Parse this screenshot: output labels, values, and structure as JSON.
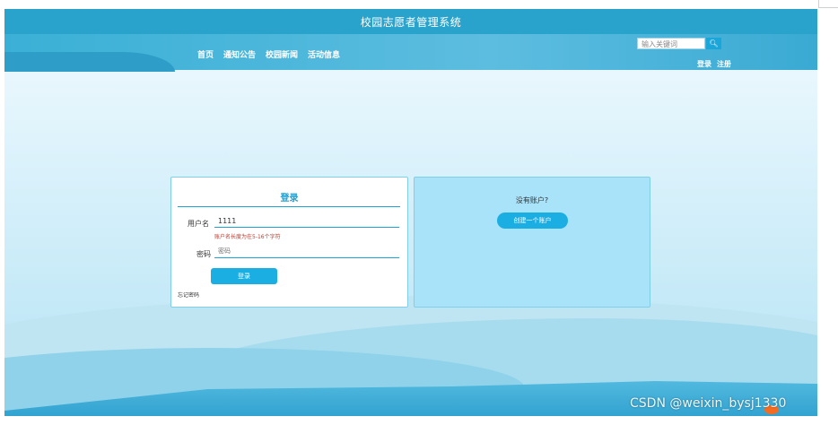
{
  "site": {
    "title": "校园志愿者管理系统"
  },
  "nav": {
    "items": [
      "首页",
      "通知公告",
      "校园新闻",
      "活动信息"
    ]
  },
  "search": {
    "placeholder": "输入关键词",
    "button_icon": "search-icon"
  },
  "auth": {
    "login": "登录",
    "register": "注册"
  },
  "login_form": {
    "title": "登录",
    "username_label": "用户名",
    "username_value": "1111",
    "username_error": "账户名长度为在5-16个字符",
    "password_label": "密码",
    "password_placeholder": "密码",
    "submit_label": "登录",
    "forgot_label": "忘记密码"
  },
  "register_panel": {
    "prompt": "没有账户?",
    "button_label": "创建一个账户"
  },
  "watermark": "CSDN @weixin_bysj1330",
  "colors": {
    "header": "#2aa3cc",
    "accent": "#1aaee3",
    "error": "#c0392b",
    "register_panel": "#a8e3fa"
  }
}
